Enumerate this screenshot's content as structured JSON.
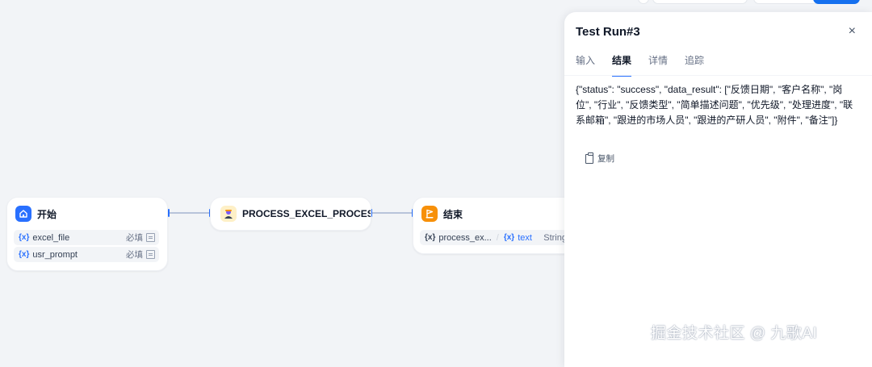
{
  "nodes": {
    "start": {
      "title": "开始",
      "vars": [
        {
          "name": "excel_file",
          "required": "必填"
        },
        {
          "name": "usr_prompt",
          "required": "必填"
        }
      ]
    },
    "process": {
      "title": "PROCESS_EXCEL_PROCESS_I"
    },
    "end": {
      "title": "结束",
      "output": {
        "var": "process_ex...",
        "ref": "text",
        "type": "String"
      }
    }
  },
  "var_symbol": "{x}",
  "panel": {
    "title": "Test Run#3",
    "close": "×",
    "tabs": [
      "输入",
      "结果",
      "详情",
      "追踪"
    ],
    "active_tab": "结果",
    "result": "{\"status\": \"success\", \"data_result\": [\"反馈日期\", \"客户名称\", \"岗位\", \"行业\", \"反馈类型\", \"简单描述问题\", \"优先级\", \"处理进度\", \"联系邮箱\", \"跟进的市场人员\", \"跟进的产研人员\", \"附件\", \"备注\"]}",
    "copy_label": "复制"
  },
  "watermark": "掘金技术社区 @ 九歌AI",
  "colors": {
    "background": "#f2f4f7",
    "accent": "#2970ff",
    "start_icon": "#2970ff",
    "end_icon": "#f79009",
    "process_icon": "#fef0c7"
  },
  "icons": {
    "start": "home-icon",
    "process": "agent-avatar-icon",
    "end": "flag-icon",
    "copy": "clipboard-icon",
    "close": "close-icon"
  }
}
